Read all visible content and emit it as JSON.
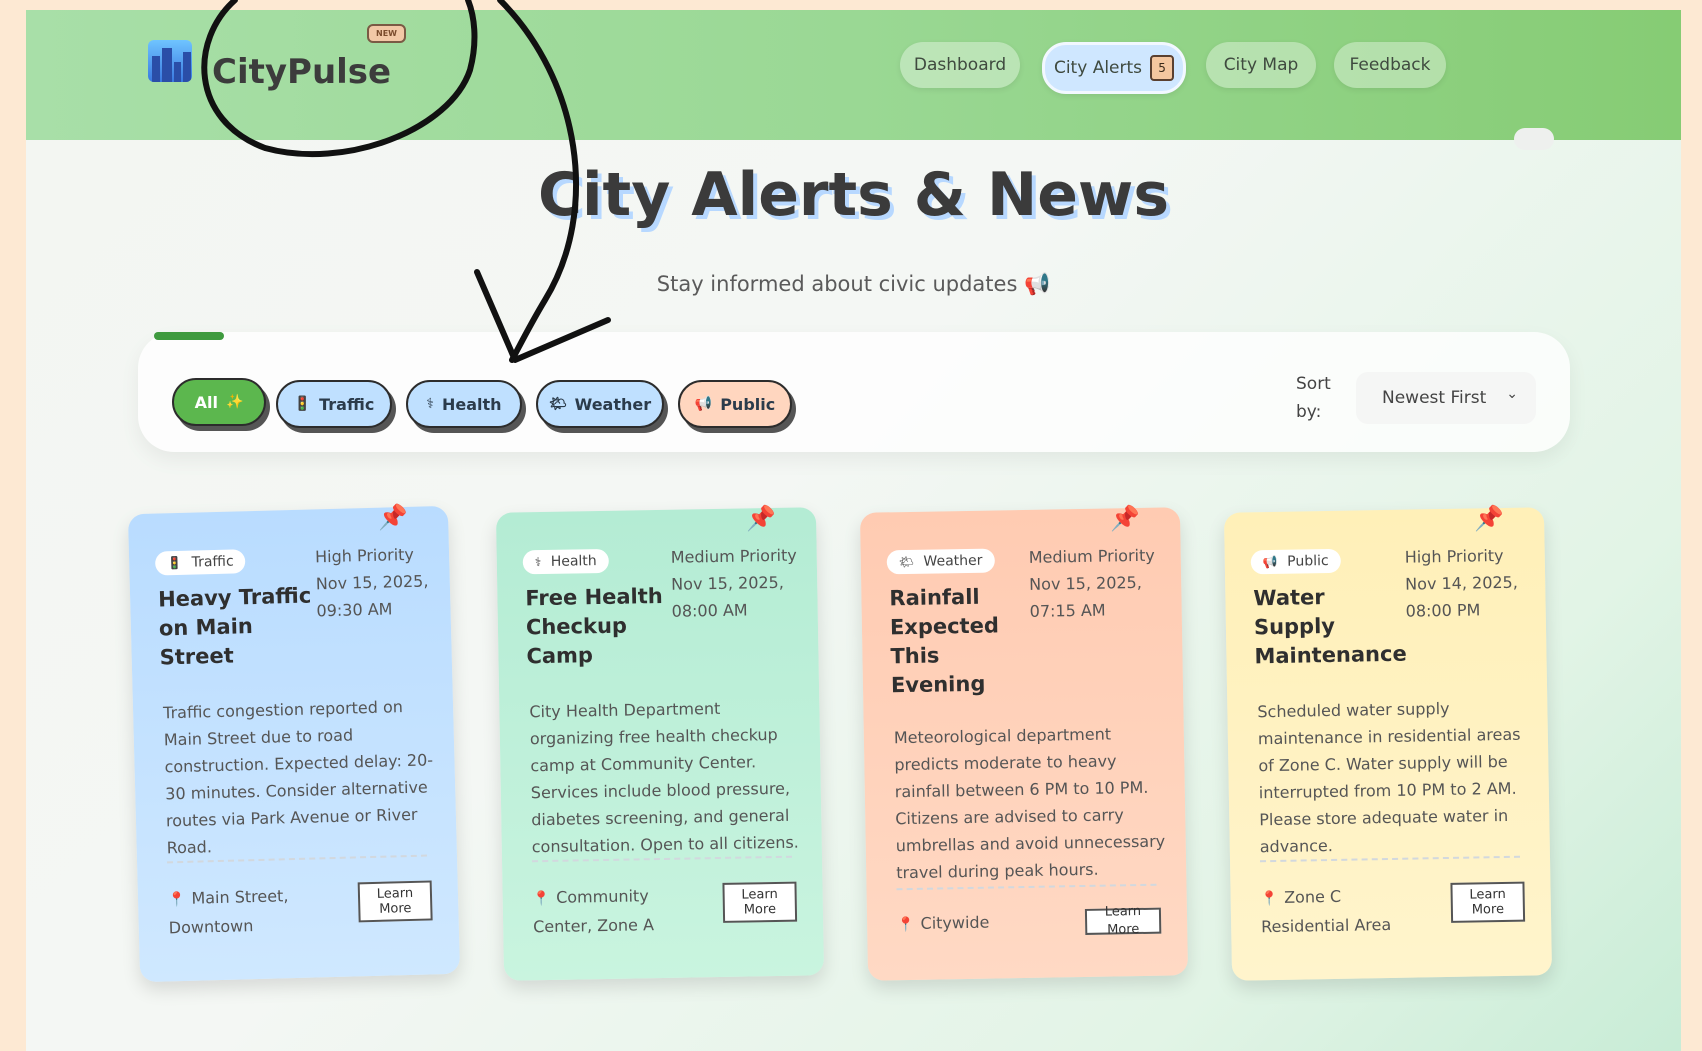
{
  "app": {
    "name": "CityPulse",
    "new_badge": "NEW"
  },
  "nav": [
    {
      "label": "Dashboard",
      "active": false
    },
    {
      "label": "City Alerts",
      "active": true,
      "count": "5"
    },
    {
      "label": "City Map",
      "active": false
    },
    {
      "label": "Feedback",
      "active": false
    }
  ],
  "page": {
    "title": "City Alerts & News",
    "subtitle": "Stay informed about civic updates 📢"
  },
  "filters": [
    {
      "label": "All",
      "icon": "✨"
    },
    {
      "label": "Traffic",
      "icon": "🚦"
    },
    {
      "label": "Health",
      "icon": "⚕"
    },
    {
      "label": "Weather",
      "icon": "🌤"
    },
    {
      "label": "Public",
      "icon": "📢"
    }
  ],
  "sort": {
    "label": "Sort by:",
    "value": "Newest First"
  },
  "cards": [
    {
      "category": "Traffic",
      "category_icon": "🚦",
      "priority": "High Priority",
      "date": "Nov 15, 2025,",
      "time": "09:30 AM",
      "title": "Heavy Traffic on Main Street",
      "description": "Traffic congestion reported on Main Street due to road construction. Expected delay: 20-30 minutes. Consider alternative routes via Park Avenue or River Road.",
      "location": "Main Street, Downtown",
      "action": "Learn More"
    },
    {
      "category": "Health",
      "category_icon": "⚕",
      "priority": "Medium Priority",
      "date": "Nov 15, 2025,",
      "time": "08:00 AM",
      "title": "Free Health Checkup Camp",
      "description": "City Health Department organizing free health checkup camp at Community Center. Services include blood pressure, diabetes screening, and general consultation. Open to all citizens.",
      "location": "Community Center, Zone A",
      "action": "Learn More"
    },
    {
      "category": "Weather",
      "category_icon": "🌤",
      "priority": "Medium Priority",
      "date": "Nov 15, 2025,",
      "time": "07:15 AM",
      "title": "Rainfall Expected This Evening",
      "description": "Meteorological department predicts moderate to heavy rainfall between 6 PM to 10 PM. Citizens are advised to carry umbrellas and avoid unnecessary travel during peak hours.",
      "location": "Citywide",
      "action": "Learn More"
    },
    {
      "category": "Public",
      "category_icon": "📢",
      "priority": "High Priority",
      "date": "Nov 14, 2025,",
      "time": "08:00 PM",
      "title": "Water Supply Maintenance",
      "description": "Scheduled water supply maintenance in residential areas of Zone C. Water supply will be interrupted from 10 PM to 2 AM. Please store adequate water in advance.",
      "location": "Zone C Residential Area",
      "action": "Learn More"
    }
  ],
  "colors": {
    "header": "#9ad894",
    "accent_green": "#5cb74e",
    "chip_blue": "#bfe0ff",
    "chip_peach": "#ffd6bf",
    "pin": "#e2456a"
  }
}
